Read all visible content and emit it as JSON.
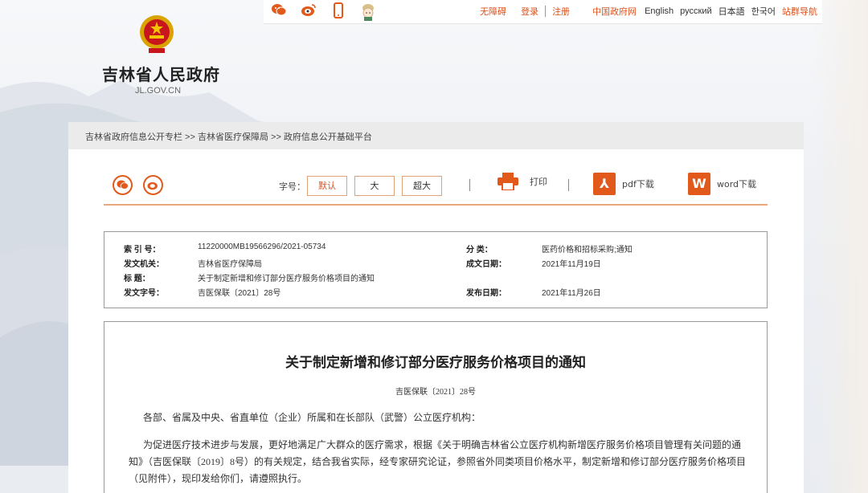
{
  "topbar": {
    "links": {
      "accessible": "无障碍",
      "login": "登录",
      "register": "注册",
      "gov": "中国政府网",
      "english": "English",
      "russian": "русский",
      "japanese": "日本語",
      "korean": "한국어",
      "sitemap": "站群导航"
    }
  },
  "header": {
    "title": "吉林省人民政府",
    "subtitle": "JL.GOV.CN"
  },
  "breadcrumb": "吉林省政府信息公开专栏 >> 吉林省医疗保障局 >> 政府信息公开基础平台",
  "toolbar": {
    "font_label": "字号：",
    "font_default": "默认",
    "font_large": "大",
    "font_xlarge": "超大",
    "print": "打印",
    "pdf": "pdf下载",
    "word": "word下载",
    "pdf_icon_letter": "⅄",
    "word_icon_letter": "W"
  },
  "info": {
    "index_label": "索  引  号：",
    "index_value": "11220000MB19566296/2021-05734",
    "category_label": "分      类：",
    "category_value": "医药价格和招标采购;通知",
    "issuer_label": "发文机关：",
    "issuer_value": "吉林省医疗保障局",
    "date_written_label": "成文日期：",
    "date_written_value": "2021年11月19日",
    "title_label": "标      题：",
    "title_value": "关于制定新增和修订部分医疗服务价格项目的通知",
    "docno_label": "发文字号：",
    "docno_value": "吉医保联〔2021〕28号",
    "pub_date_label": "发布日期：",
    "pub_date_value": "2021年11月26日"
  },
  "article": {
    "title": "关于制定新增和修订部分医疗服务价格项目的通知",
    "docno": "吉医保联〔2021〕28号",
    "salutation": "各部、省属及中央、省直单位（企业）所属和在长部队（武警）公立医疗机构：",
    "body": "为促进医疗技术进步与发展，更好地满足广大群众的医疗需求，根据《关于明确吉林省公立医疗机构新增医疗服务价格项目管理有关问题的通知》（吉医保联〔2019〕8号）的有关规定，结合我省实际，经专家研究论证，参照省外同类项目价格水平，制定新增和修订部分医疗服务价格项目（见附件），现印发给你们，请遵照执行。"
  },
  "colors": {
    "accent": "#e1591b",
    "border_accent": "#e8a87c"
  }
}
